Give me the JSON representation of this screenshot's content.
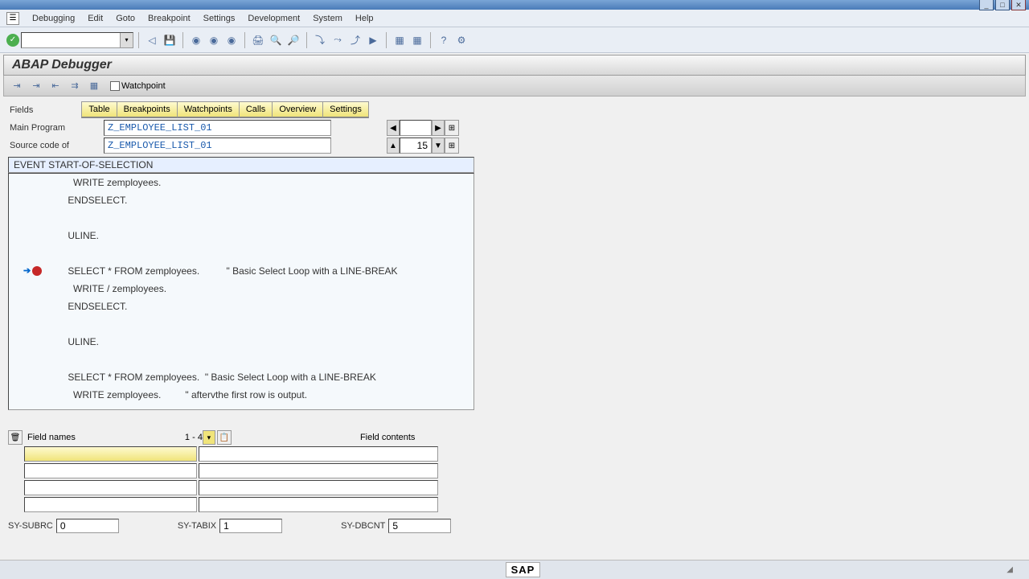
{
  "window": {
    "title": ""
  },
  "menu": {
    "items": [
      "Debugging",
      "Edit",
      "Goto",
      "Breakpoint",
      "Settings",
      "Development",
      "System",
      "Help"
    ]
  },
  "page_title": "ABAP Debugger",
  "subtoolbar": {
    "watchpoint": "Watchpoint"
  },
  "tabs": {
    "label": "Fields",
    "items": [
      "Table",
      "Breakpoints",
      "Watchpoints",
      "Calls",
      "Overview",
      "Settings"
    ]
  },
  "form": {
    "main_program_label": "Main Program",
    "main_program_value": "Z_EMPLOYEE_LIST_01",
    "source_of_label": "Source code of",
    "source_of_value": "Z_EMPLOYEE_LIST_01",
    "nav_value": "",
    "line_value": "15"
  },
  "event_header": "EVENT START-OF-SELECTION",
  "code_lines": [
    {
      "indent": "      ",
      "text": "WRITE zemployees."
    },
    {
      "indent": "    ",
      "text": "ENDSELECT."
    },
    {
      "indent": "",
      "text": ""
    },
    {
      "indent": "    ",
      "text": "ULINE."
    },
    {
      "indent": "",
      "text": ""
    },
    {
      "indent": "    ",
      "text": "SELECT * FROM zemployees.          \" Basic Select Loop with a LINE-BREAK",
      "arrow": true,
      "bp": true
    },
    {
      "indent": "      ",
      "text": "WRITE / zemployees."
    },
    {
      "indent": "    ",
      "text": "ENDSELECT."
    },
    {
      "indent": "",
      "text": ""
    },
    {
      "indent": "    ",
      "text": "ULINE."
    },
    {
      "indent": "",
      "text": ""
    },
    {
      "indent": "    ",
      "text": "SELECT * FROM zemployees.  \" Basic Select Loop with a LINE-BREAK"
    },
    {
      "indent": "      ",
      "text": "WRITE zemployees.         \" aftervthe first row is output."
    }
  ],
  "fields_area": {
    "names_label": "Field names",
    "range": "1 - 4",
    "contents_label": "Field contents"
  },
  "sy_row": {
    "subrc_label": "SY-SUBRC",
    "subrc_value": "0",
    "tabix_label": "SY-TABIX",
    "tabix_value": "1",
    "dbcnt_label": "SY-DBCNT",
    "dbcnt_value": "5"
  },
  "statusbar": {
    "logo": "SAP"
  }
}
